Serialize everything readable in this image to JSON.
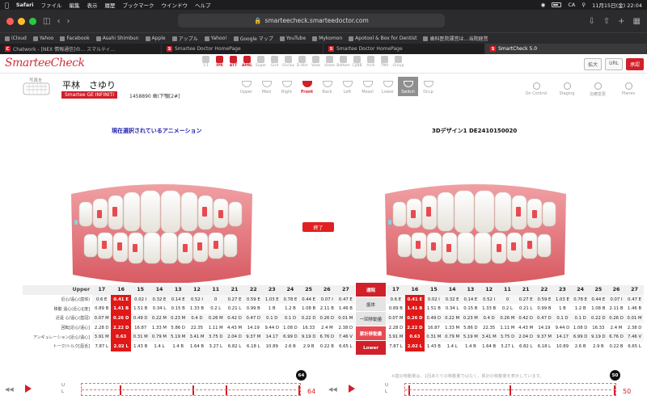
{
  "mac_menu": {
    "apple": "",
    "app": "Safari",
    "items": [
      "ファイル",
      "編集",
      "表示",
      "履歴",
      "ブックマーク",
      "ウインドウ",
      "ヘルプ"
    ],
    "status_input": "CA",
    "datetime": "11月15日(金) 22:04"
  },
  "browser": {
    "url": "smarteecheck.smarteedoctor.com",
    "bookmarks": [
      "iCloud",
      "Yahoo",
      "Facebook",
      "Asahi Shimbun",
      "Apple",
      "アップル",
      "Yahoo!",
      "Google マップ",
      "YouTube",
      "Mykomon",
      "Apotool & Box for Dentist",
      "歯科医院運営は…当院経営"
    ],
    "tabs": [
      {
        "label": "Chatwork - [NEX 情報通信]の... スマルティ...",
        "active": false
      },
      {
        "label": "Smartee Doctor HomePage",
        "active": false
      },
      {
        "label": "Smartee Doctor HomePage",
        "active": false
      },
      {
        "label": "SmartCheck 5.0",
        "active": true
      }
    ]
  },
  "app": {
    "logo": "SmarteeCheck",
    "top_tools": [
      {
        "label": "1:1",
        "active": false
      },
      {
        "label": "IPR",
        "active": true
      },
      {
        "label": "ATT",
        "active": true
      },
      {
        "label": "APRL",
        "active": true
      },
      {
        "label": "Super",
        "active": false
      },
      {
        "label": "Grid",
        "active": false
      },
      {
        "label": "Occlus",
        "active": false
      },
      {
        "label": "D.Hist",
        "active": false
      },
      {
        "label": "View",
        "active": false
      },
      {
        "label": "Views",
        "active": false
      },
      {
        "label": "Bottom",
        "active": false
      },
      {
        "label": "CJ/BB",
        "active": false
      },
      {
        "label": "Arch",
        "active": false
      },
      {
        "label": "TMA",
        "active": false
      },
      {
        "label": "Group",
        "active": false
      }
    ],
    "header_buttons": [
      {
        "label": "拡大",
        "style": "plain"
      },
      {
        "label": "URL",
        "style": "plain"
      },
      {
        "label": "承認",
        "style": "red"
      }
    ]
  },
  "patient": {
    "face_label": "写真を",
    "name": "平林　さゆり",
    "product": "Smartee GE INFINITI",
    "id_text": "1458890 歯(下顎[2#]"
  },
  "view_tools": [
    {
      "label": "Upper",
      "state": "normal"
    },
    {
      "label": "Mesl",
      "state": "normal"
    },
    {
      "label": "Right",
      "state": "normal"
    },
    {
      "label": "Front",
      "state": "active"
    },
    {
      "label": "Back",
      "state": "normal"
    },
    {
      "label": "Left",
      "state": "normal"
    },
    {
      "label": "Mesol",
      "state": "normal"
    },
    {
      "label": "Lower",
      "state": "normal"
    },
    {
      "label": "Switch",
      "state": "dark"
    },
    {
      "label": "Occp",
      "state": "normal"
    }
  ],
  "right_tools": [
    "On Control",
    "Staging",
    "治療変更",
    "Planes"
  ],
  "left_panel": {
    "title": "現在選択されているアニメーション"
  },
  "right_panel": {
    "title": "3Dデザイン1 DE2410150020"
  },
  "finish_button": "終了",
  "table_left": {
    "header_label": "Upper",
    "teeth": [
      "17",
      "16",
      "15",
      "14",
      "13",
      "12",
      "11",
      "21",
      "22",
      "23",
      "24",
      "25",
      "26",
      "27"
    ],
    "rows": [
      {
        "label": "近心/遠心(歯体)",
        "cells": [
          "0.6 E",
          "0.41 E",
          "0.02 I",
          "0.32 E",
          "0.14 E",
          "0.52 I",
          "0",
          "0.27 E",
          "0.59 E",
          "1.03 E",
          "0.78 E",
          "0.44 E",
          "0.07 I",
          "0.47 E"
        ]
      },
      {
        "label": "移動 遠心(近心)[度]",
        "cells": [
          "0.89 B",
          "1.41 B",
          "1.51 B",
          "0.34 L",
          "0.15 B",
          "1.33 B",
          "0.2 L",
          "0.21 L",
          "0.99 B",
          "1 B",
          "1.2 B",
          "1.08 B",
          "2.11 B",
          "1.46 B"
        ]
      },
      {
        "label": "近遠 心/遠心(歯冠)",
        "cells": [
          "0.07 M",
          "0.26 D",
          "0.49 D",
          "0.22 M",
          "0.23 M",
          "0.4 D",
          "0.26 M",
          "0.42 D",
          "0.47 D",
          "0.1 D",
          "0.1 D",
          "0.22 D",
          "0.26 D",
          "0.01 M"
        ]
      },
      {
        "label": "回転[近心/遠心]",
        "cells": [
          "2.28 D",
          "2.22 D",
          "16.87",
          "1.33 M",
          "5.86 D",
          "22.35",
          "1.11 M",
          "4.43 M",
          "14.19",
          "9.44 D",
          "1.08 D",
          "16.33",
          "2.4 M",
          "2.38 D"
        ]
      },
      {
        "label": "アンギュレーション[近心/遠心]",
        "cells": [
          "3.91 M",
          "0.63",
          "0.31 M",
          "0.79 M",
          "5.19 M",
          "3.41 M",
          "3.75 D",
          "2.04 D",
          "9.37 M",
          "14.17",
          "6.99 D",
          "9.19 D",
          "6.76 D",
          "7.46 V"
        ]
      },
      {
        "label": "トーク/トルク[唇舌]",
        "cells": [
          "7.87 L",
          "2.02 L",
          "1.43 B",
          "1.4 L",
          "1.4 B",
          "1.64 B",
          "3.27 L",
          "6.82 L",
          "6.18 L",
          "10.89",
          "2.6 B",
          "2.9 B",
          "0.22 B",
          "6.65 L"
        ]
      }
    ],
    "highlight_col": 1
  },
  "table_right": {
    "teeth": [
      "17",
      "16",
      "15",
      "14",
      "13",
      "12",
      "11",
      "21",
      "22",
      "23",
      "24",
      "25",
      "26",
      "27"
    ],
    "rows": [
      {
        "cells": [
          "0.6 E",
          "0.41 E",
          "0.02 I",
          "0.32 E",
          "0.14 E",
          "0.52 I",
          "0",
          "0.27 E",
          "0.59 E",
          "1.03 E",
          "0.78 E",
          "0.44 E",
          "0.07 I",
          "0.47 E"
        ]
      },
      {
        "cells": [
          "0.89 B",
          "1.41 B",
          "1.51 B",
          "0.34 L",
          "0.15 B",
          "1.33 B",
          "0.2 L",
          "0.21 L",
          "0.99 B",
          "1 B",
          "1.2 B",
          "1.08 B",
          "2.11 B",
          "1.46 B"
        ]
      },
      {
        "cells": [
          "0.07 M",
          "0.26 D",
          "0.49 D",
          "0.22 M",
          "0.23 M",
          "0.4 D",
          "0.26 M",
          "0.42 D",
          "0.47 D",
          "0.1 D",
          "0.1 D",
          "0.22 D",
          "0.26 D",
          "0.01 M"
        ]
      },
      {
        "cells": [
          "2.28 D",
          "2.22 D",
          "16.87",
          "1.33 M",
          "5.86 D",
          "22.35",
          "1.11 M",
          "4.43 M",
          "14.19",
          "9.44 D",
          "1.08 D",
          "16.33",
          "2.4 M",
          "2.38 D"
        ]
      },
      {
        "cells": [
          "3.91 M",
          "0.63",
          "0.31 M",
          "0.79 M",
          "5.19 M",
          "3.41 M",
          "3.75 D",
          "2.04 D",
          "9.37 M",
          "14.17",
          "6.99 D",
          "9.19 D",
          "6.76 D",
          "7.46 V"
        ]
      },
      {
        "cells": [
          "7.87 L",
          "2.02 L",
          "1.43 B",
          "1.4 L",
          "1.4 B",
          "1.64 B",
          "3.27 L",
          "6.82 L",
          "6.18 L",
          "10.89",
          "2.6 B",
          "2.9 B",
          "0.22 B",
          "6.65 L"
        ]
      }
    ],
    "highlight_col": 1
  },
  "center_buttons": [
    {
      "label": "通院",
      "style": "red"
    },
    {
      "label": "歯体",
      "style": "gray"
    },
    {
      "label": "一回移動量",
      "style": "gray"
    },
    {
      "label": "累計移動量",
      "style": "pink"
    },
    {
      "label": "Lower",
      "style": "red"
    }
  ],
  "footnote": "※歯の移動量は、1回あたりの移動量ではなく、累計の移動量を表示しています。",
  "timeline_left": {
    "upper_label": "U",
    "lower_label": "L",
    "stage": "64",
    "count": "64"
  },
  "timeline_right": {
    "upper_label": "U",
    "lower_label": "L",
    "stage": "50",
    "count": "50"
  },
  "colors": {
    "brand_red": "#d0202a",
    "highlight_red": "#e01818",
    "gum": "#e8737a"
  }
}
